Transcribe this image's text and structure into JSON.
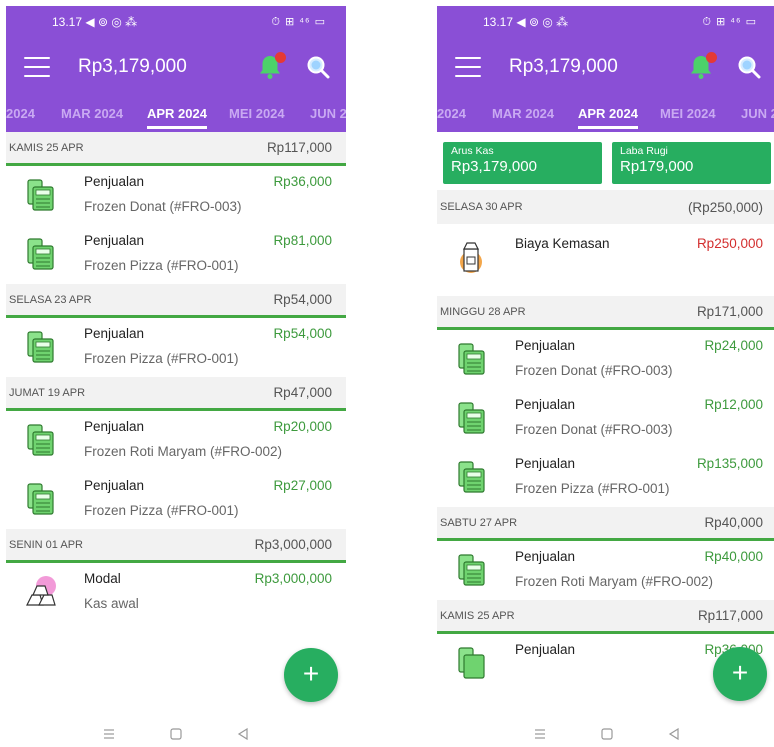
{
  "colors": {
    "header": "#8a4fd6",
    "green": "#27ae60",
    "line_green": "#43a843",
    "red": "#d32f2f",
    "badge": "#e53935"
  },
  "statusbar": {
    "time": "13.17",
    "left_icons": "◀ ⊚ ◎ ⁂",
    "right_icons": "⏱ ⊞ ⁴⁶ ▭"
  },
  "left": {
    "balance": "Rp3,179,000",
    "tabs": [
      "2024",
      "MAR 2024",
      "APR 2024",
      "MEI 2024",
      "JUN 2"
    ],
    "active_tab": "APR 2024",
    "groups": [
      {
        "date": "KAMIS 25 APR",
        "total": "Rp117,000",
        "items": [
          {
            "icon": "cash-register-icon",
            "title": "Penjualan",
            "desc": "Frozen Donat (#FRO-003)",
            "amount": "Rp36,000",
            "type": "income"
          },
          {
            "icon": "cash-register-icon",
            "title": "Penjualan",
            "desc": "Frozen Pizza  (#FRO-001)",
            "amount": "Rp81,000",
            "type": "income"
          }
        ]
      },
      {
        "date": "SELASA 23 APR",
        "total": "Rp54,000",
        "items": [
          {
            "icon": "cash-register-icon",
            "title": "Penjualan",
            "desc": "Frozen Pizza  (#FRO-001)",
            "amount": "Rp54,000",
            "type": "income"
          }
        ]
      },
      {
        "date": "JUMAT 19 APR",
        "total": "Rp47,000",
        "items": [
          {
            "icon": "cash-register-icon",
            "title": "Penjualan",
            "desc": "Frozen Roti Maryam  (#FRO-002)",
            "amount": "Rp20,000",
            "type": "income"
          },
          {
            "icon": "cash-register-icon",
            "title": "Penjualan",
            "desc": "Frozen Pizza  (#FRO-001)",
            "amount": "Rp27,000",
            "type": "income"
          }
        ]
      },
      {
        "date": "SENIN 01 APR",
        "total": "Rp3,000,000",
        "items": [
          {
            "icon": "gold-bars-icon",
            "title": "Modal",
            "desc": "Kas awal",
            "amount": "Rp3,000,000",
            "type": "income"
          }
        ]
      }
    ]
  },
  "right": {
    "balance": "Rp3,179,000",
    "tabs": [
      "2024",
      "MAR 2024",
      "APR 2024",
      "MEI 2024",
      "JUN 2"
    ],
    "active_tab": "APR 2024",
    "summary": {
      "arus_kas_label": "Arus Kas",
      "arus_kas_value": "Rp3,179,000",
      "laba_rugi_label": "Laba Rugi",
      "laba_rugi_value": "Rp179,000"
    },
    "groups": [
      {
        "date": "SELASA 30 APR",
        "total": "(Rp250,000)",
        "items": [
          {
            "icon": "package-box-icon",
            "title": "Biaya Kemasan",
            "desc": "",
            "amount": "Rp250,000",
            "type": "expense"
          }
        ]
      },
      {
        "date": "MINGGU 28 APR",
        "total": "Rp171,000",
        "items": [
          {
            "icon": "cash-register-icon",
            "title": "Penjualan",
            "desc": "Frozen Donat (#FRO-003)",
            "amount": "Rp24,000",
            "type": "income"
          },
          {
            "icon": "cash-register-icon",
            "title": "Penjualan",
            "desc": "Frozen Donat (#FRO-003)",
            "amount": "Rp12,000",
            "type": "income"
          },
          {
            "icon": "cash-register-icon",
            "title": "Penjualan",
            "desc": "Frozen Pizza  (#FRO-001)",
            "amount": "Rp135,000",
            "type": "income"
          }
        ]
      },
      {
        "date": "SABTU 27 APR",
        "total": "Rp40,000",
        "items": [
          {
            "icon": "cash-register-icon",
            "title": "Penjualan",
            "desc": "Frozen Roti Maryam  (#FRO-002)",
            "amount": "Rp40,000",
            "type": "income"
          }
        ]
      },
      {
        "date": "KAMIS 25 APR",
        "total": "Rp117,000",
        "items": [
          {
            "icon": "cash-register-icon",
            "title": "Penjualan",
            "desc": "",
            "amount": "Rp36,000",
            "type": "income"
          }
        ]
      }
    ]
  },
  "fab_label": "+"
}
